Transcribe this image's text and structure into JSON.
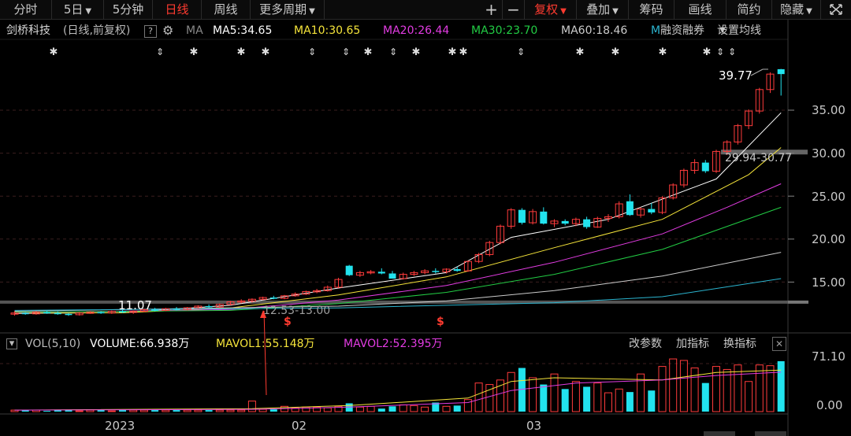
{
  "toolbar": {
    "items": [
      "分时",
      "5日",
      "5分钟",
      "日线",
      "周线",
      "更多周期"
    ],
    "right_items": [
      "+",
      "−",
      "复权",
      "叠加",
      "筹码",
      "画线",
      "简约",
      "隐藏"
    ],
    "expand_icon": "expand-arrows-icon"
  },
  "info": {
    "stock_name": "剑桥科技",
    "period_label": "(日线,前复权)",
    "help": "?",
    "ma_label": "MA",
    "ma5": "MA5:34.65",
    "ma10": "MA10:30.65",
    "ma20": "MA20:26.44",
    "ma30": "MA30:23.70",
    "ma60": "MA60:18.46",
    "m_trunc": "M",
    "margin_trading": "融资融券",
    "ma_settings": "设置均线"
  },
  "annotations": {
    "high": "39.77",
    "box_range": "29.94-30.77",
    "low": "11.07",
    "bottom_range": "12.53-13.00",
    "marker": "$"
  },
  "price_axis": [
    "35.00",
    "30.00",
    "25.00",
    "20.00",
    "15.00"
  ],
  "volume_axis": [
    "71.10",
    "0.00"
  ],
  "time_axis": [
    "2023",
    "02",
    "03"
  ],
  "volume_info": {
    "label": "VOL(5,10)",
    "volume": "VOLUME:66.938万",
    "mavol1": "MAVOL1:55.148万",
    "mavol2": "MAVOL2:52.395万",
    "change_params": "改参数",
    "add_indicator": "加指标",
    "switch_indicator": "换指标"
  },
  "colors": {
    "up": "#ff3b3b",
    "down": "#22e3ee",
    "ma5": "#ffffff",
    "ma10": "#f5e43a",
    "ma20": "#e23ce2",
    "ma30": "#22cc44",
    "ma60": "#cccccc",
    "ma120": "#2bb5d0"
  },
  "chart_data": {
    "type": "candlestick",
    "price_range": [
      11.07,
      39.77
    ],
    "candles": [
      [
        11.3,
        11.6,
        11.1,
        11.4
      ],
      [
        11.4,
        11.5,
        11.2,
        11.3
      ],
      [
        11.3,
        11.6,
        11.2,
        11.5
      ],
      [
        11.5,
        11.7,
        11.3,
        11.4
      ],
      [
        11.4,
        11.6,
        11.2,
        11.3
      ],
      [
        11.3,
        11.4,
        11.07,
        11.2
      ],
      [
        11.2,
        11.5,
        11.1,
        11.4
      ],
      [
        11.4,
        11.6,
        11.3,
        11.5
      ],
      [
        11.5,
        11.6,
        11.3,
        11.4
      ],
      [
        11.4,
        11.7,
        11.3,
        11.6
      ],
      [
        11.6,
        11.8,
        11.4,
        11.5
      ],
      [
        11.5,
        11.7,
        11.3,
        11.6
      ],
      [
        11.6,
        11.9,
        11.5,
        11.8
      ],
      [
        11.8,
        12.0,
        11.6,
        11.7
      ],
      [
        11.7,
        12.0,
        11.6,
        11.9
      ],
      [
        11.9,
        12.1,
        11.7,
        11.8
      ],
      [
        11.8,
        12.1,
        11.7,
        12.0
      ],
      [
        12.0,
        12.3,
        11.9,
        12.2
      ],
      [
        12.2,
        12.4,
        12.0,
        12.1
      ],
      [
        12.1,
        12.5,
        12.0,
        12.4
      ],
      [
        12.4,
        12.8,
        12.3,
        12.7
      ],
      [
        12.7,
        13.0,
        12.53,
        12.8
      ],
      [
        12.8,
        13.1,
        12.6,
        13.0
      ],
      [
        13.0,
        13.3,
        12.9,
        13.2
      ],
      [
        13.2,
        13.4,
        13.0,
        13.1
      ],
      [
        13.1,
        13.5,
        13.0,
        13.4
      ],
      [
        13.4,
        13.8,
        13.3,
        13.6
      ],
      [
        13.6,
        14.0,
        13.5,
        13.9
      ],
      [
        13.9,
        14.2,
        13.7,
        14.0
      ],
      [
        14.0,
        14.6,
        13.9,
        14.4
      ],
      [
        14.4,
        15.5,
        14.3,
        15.3
      ],
      [
        16.9,
        17.0,
        15.7,
        15.8
      ],
      [
        15.8,
        16.3,
        15.6,
        16.1
      ],
      [
        16.1,
        16.4,
        15.9,
        16.2
      ],
      [
        16.2,
        16.6,
        15.9,
        16.0
      ],
      [
        16.0,
        16.3,
        15.4,
        15.4
      ],
      [
        15.4,
        16.1,
        15.3,
        15.9
      ],
      [
        15.9,
        16.3,
        15.7,
        16.1
      ],
      [
        16.1,
        16.5,
        15.9,
        16.3
      ],
      [
        16.3,
        16.6,
        16.0,
        16.2
      ],
      [
        16.2,
        16.6,
        16.0,
        16.5
      ],
      [
        16.5,
        16.8,
        16.2,
        16.3
      ],
      [
        16.3,
        17.5,
        16.2,
        17.4
      ],
      [
        17.4,
        18.4,
        17.2,
        18.2
      ],
      [
        18.2,
        19.8,
        18.0,
        19.6
      ],
      [
        19.6,
        21.7,
        19.4,
        21.5
      ],
      [
        21.5,
        23.6,
        21.2,
        23.4
      ],
      [
        23.4,
        23.6,
        21.7,
        21.9
      ],
      [
        21.9,
        23.5,
        21.7,
        23.2
      ],
      [
        23.2,
        23.7,
        21.7,
        21.8
      ],
      [
        21.8,
        22.3,
        21.4,
        22.1
      ],
      [
        22.1,
        22.3,
        21.6,
        21.8
      ],
      [
        21.8,
        22.5,
        21.5,
        22.3
      ],
      [
        22.3,
        22.6,
        21.2,
        21.4
      ],
      [
        21.4,
        22.6,
        21.3,
        22.4
      ],
      [
        22.4,
        22.9,
        22.0,
        22.6
      ],
      [
        22.6,
        24.4,
        22.4,
        24.1
      ],
      [
        24.4,
        25.2,
        22.7,
        22.8
      ],
      [
        22.8,
        23.7,
        22.5,
        23.5
      ],
      [
        23.5,
        24.2,
        22.9,
        23.1
      ],
      [
        23.1,
        25.0,
        22.9,
        24.8
      ],
      [
        24.8,
        26.5,
        24.6,
        26.3
      ],
      [
        26.3,
        28.2,
        26.0,
        28.0
      ],
      [
        28.0,
        29.3,
        27.6,
        28.9
      ],
      [
        28.9,
        29.2,
        27.7,
        27.9
      ],
      [
        27.9,
        30.4,
        27.7,
        30.2
      ],
      [
        30.2,
        31.5,
        29.8,
        31.3
      ],
      [
        31.3,
        33.4,
        31.0,
        33.2
      ],
      [
        33.2,
        35.1,
        32.8,
        34.9
      ],
      [
        34.9,
        37.6,
        34.6,
        37.4
      ],
      [
        37.4,
        39.4,
        37.0,
        39.2
      ],
      [
        39.77,
        39.8,
        36.7,
        39.2
      ]
    ],
    "ma": {
      "ma5": [
        [
          0,
          11.35
        ],
        [
          10,
          11.45
        ],
        [
          20,
          12.3
        ],
        [
          30,
          14.3
        ],
        [
          40,
          16.1
        ],
        [
          46,
          20.2
        ],
        [
          55,
          22.3
        ],
        [
          65,
          27.0
        ],
        [
          71,
          34.7
        ]
      ],
      "ma10": [
        [
          0,
          11.4
        ],
        [
          10,
          11.42
        ],
        [
          20,
          12.0
        ],
        [
          30,
          13.5
        ],
        [
          40,
          15.6
        ],
        [
          50,
          19.0
        ],
        [
          60,
          22.3
        ],
        [
          68,
          27.5
        ],
        [
          71,
          30.65
        ]
      ],
      "ma20": [
        [
          0,
          11.45
        ],
        [
          20,
          11.8
        ],
        [
          30,
          12.9
        ],
        [
          40,
          14.6
        ],
        [
          50,
          17.3
        ],
        [
          60,
          20.6
        ],
        [
          66,
          23.7
        ],
        [
          71,
          26.44
        ]
      ],
      "ma30": [
        [
          0,
          11.5
        ],
        [
          20,
          11.7
        ],
        [
          30,
          12.5
        ],
        [
          40,
          13.8
        ],
        [
          50,
          15.9
        ],
        [
          60,
          18.8
        ],
        [
          71,
          23.7
        ]
      ],
      "ma60": [
        [
          0,
          11.6
        ],
        [
          30,
          12.2
        ],
        [
          40,
          12.8
        ],
        [
          50,
          14.0
        ],
        [
          60,
          15.7
        ],
        [
          71,
          18.46
        ]
      ],
      "ma120": [
        [
          0,
          11.7
        ],
        [
          30,
          12.0
        ],
        [
          50,
          12.6
        ],
        [
          60,
          13.3
        ],
        [
          71,
          15.4
        ]
      ]
    },
    "volume": [
      2,
      2,
      2,
      1,
      2,
      2,
      1,
      2,
      2,
      1,
      2,
      2,
      2,
      2,
      2,
      2,
      2,
      2,
      2,
      2,
      2,
      2,
      14,
      3,
      3,
      7,
      5,
      6,
      6,
      5,
      7,
      11,
      6,
      7,
      4,
      7,
      9,
      8,
      6,
      12,
      7,
      8,
      16,
      38,
      36,
      42,
      52,
      58,
      45,
      36,
      50,
      30,
      40,
      33,
      38,
      25,
      30,
      26,
      50,
      28,
      60,
      70,
      68,
      58,
      38,
      60,
      56,
      62,
      40,
      62,
      61,
      67
    ],
    "mavol1": [
      [
        0,
        2
      ],
      [
        22,
        4
      ],
      [
        31,
        8
      ],
      [
        42,
        18
      ],
      [
        46,
        40
      ],
      [
        50,
        45
      ],
      [
        60,
        42
      ],
      [
        65,
        52
      ],
      [
        71,
        55.148
      ]
    ],
    "mavol2": [
      [
        0,
        2
      ],
      [
        22,
        3
      ],
      [
        31,
        6
      ],
      [
        42,
        12
      ],
      [
        46,
        28
      ],
      [
        52,
        38
      ],
      [
        60,
        42
      ],
      [
        65,
        48
      ],
      [
        71,
        52.395
      ]
    ]
  }
}
